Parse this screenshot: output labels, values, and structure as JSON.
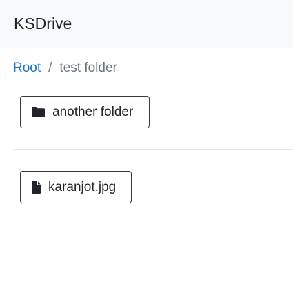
{
  "navbar": {
    "brand": "KSDrive"
  },
  "breadcrumb": {
    "root_label": "Root",
    "separator": "/",
    "current_label": "test folder"
  },
  "folders": [
    {
      "name": "another folder",
      "icon": "folder-icon"
    }
  ],
  "files": [
    {
      "name": "karanjot.jpg",
      "icon": "file-icon"
    }
  ],
  "colors": {
    "navbar_bg": "#f8f9fa",
    "link": "#1a73c9",
    "muted": "#6c757d",
    "button_border": "#343a40"
  }
}
